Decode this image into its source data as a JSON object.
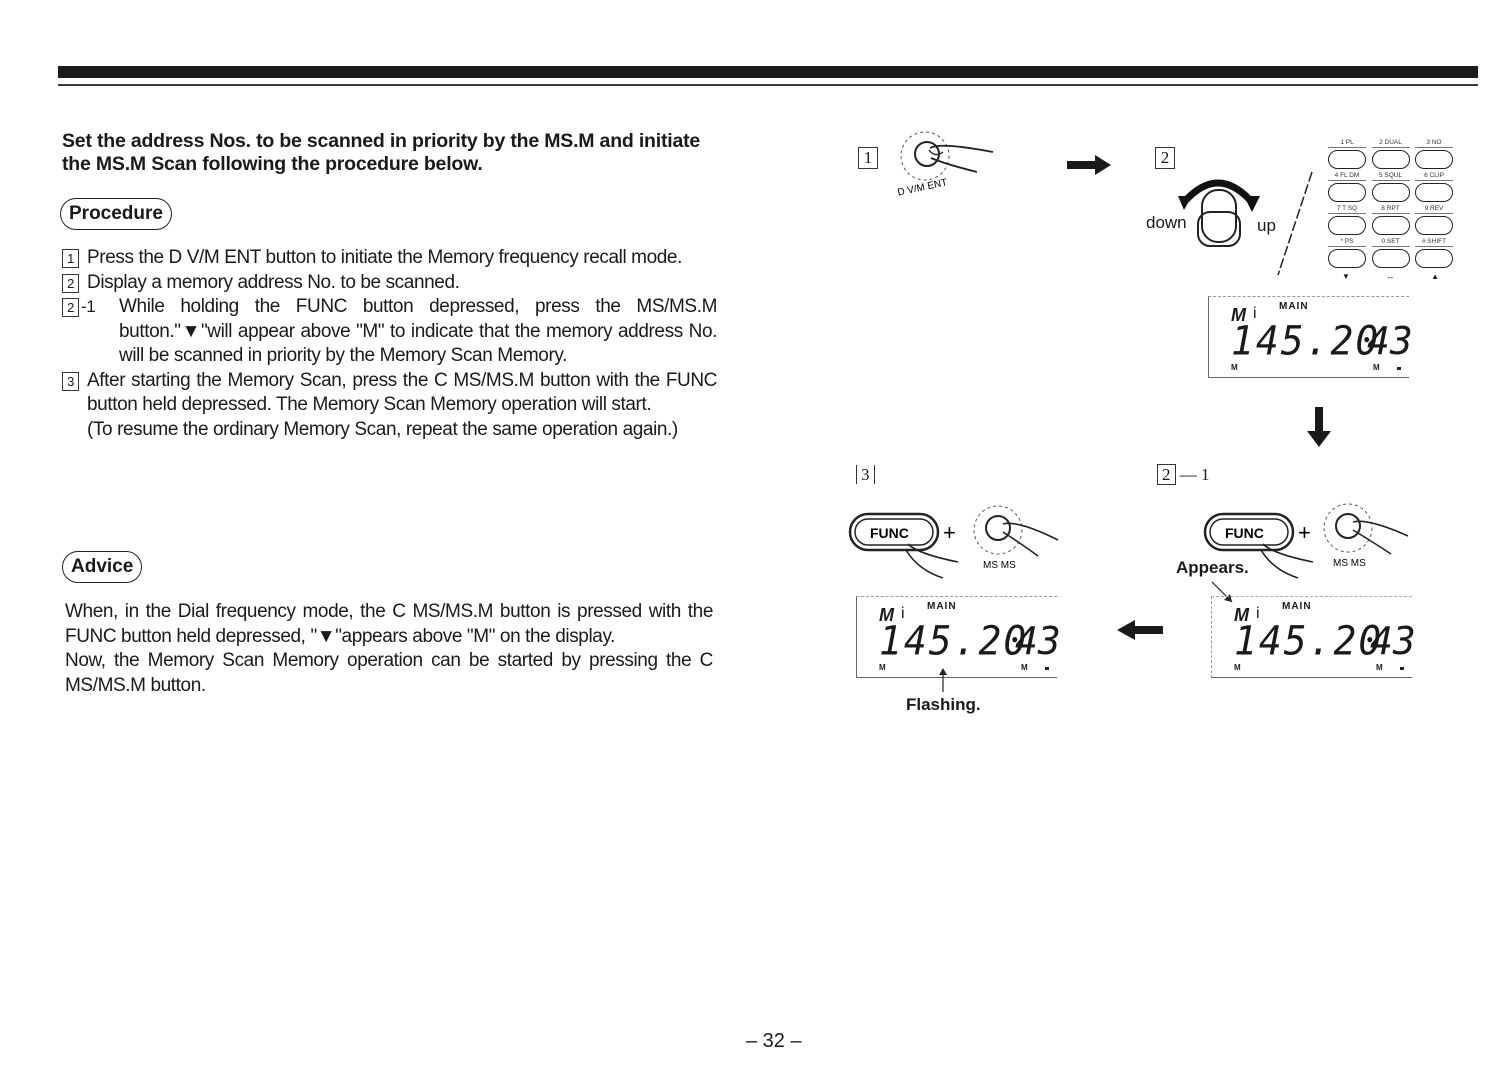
{
  "header": {
    "rule": "double-rule"
  },
  "intro": "Set the address Nos. to be scanned in priority by the MS.M and initiate the MS.M Scan following the procedure below.",
  "procedure": {
    "label": "Procedure",
    "steps": [
      {
        "num": "1",
        "text": "Press the D V/M ENT button to initiate the Memory frequency recall mode."
      },
      {
        "num": "2",
        "text": "Display a memory address No. to be scanned."
      },
      {
        "num": "2",
        "suffix": "-1",
        "text": "While holding the FUNC button depressed, press the MS/MS.M button.\"▼\"will appear above \"M\" to indicate that the memory address No. will be scanned in priority by the Memory Scan Memory."
      },
      {
        "num": "3",
        "text": "After starting the Memory Scan, press the C MS/MS.M button with the FUNC button held depressed. The Memory Scan Memory operation will start.",
        "note": "(To resume the ordinary Memory Scan, repeat the same operation again.)"
      }
    ]
  },
  "advice": {
    "label": "Advice",
    "paragraphs": [
      "When, in the Dial frequency mode, the C MS/MS.M button is pressed with the FUNC button held depressed, \"▼\"appears above \"M\" on the display.",
      "Now, the Memory Scan Memory operation can be started by pressing the C MS/MS.M button."
    ]
  },
  "diagram": {
    "step1": {
      "num": "1",
      "button_label": "D V/M ENT"
    },
    "step2": {
      "num": "2",
      "down": "down",
      "up": "up",
      "keypad": {
        "rows": [
          [
            "1 PL",
            "2 DUAL",
            "3 NO"
          ],
          [
            "4 FL DM",
            "5 SQUL",
            "6 CLIP"
          ],
          [
            "7 T SQ",
            "8 RPT",
            "9 REV"
          ],
          [
            "* PS",
            "0 SET",
            "# SHIFT"
          ]
        ],
        "bottom": [
          "▼",
          "↔",
          "▲"
        ]
      }
    },
    "step2_1": {
      "num": "2",
      "suffix": "— 1",
      "func": "FUNC",
      "ms": "MS MS",
      "appears": "Appears."
    },
    "step3": {
      "num": "3",
      "func": "FUNC",
      "ms": "MS MS",
      "flashing": "Flashing."
    },
    "lcd": {
      "m": "M",
      "bar": "i",
      "main": "MAIN",
      "freq": "145.20",
      "channel": "43",
      "m_left": "M",
      "m_right": "M"
    }
  },
  "footer": {
    "page": "– 32 –"
  }
}
